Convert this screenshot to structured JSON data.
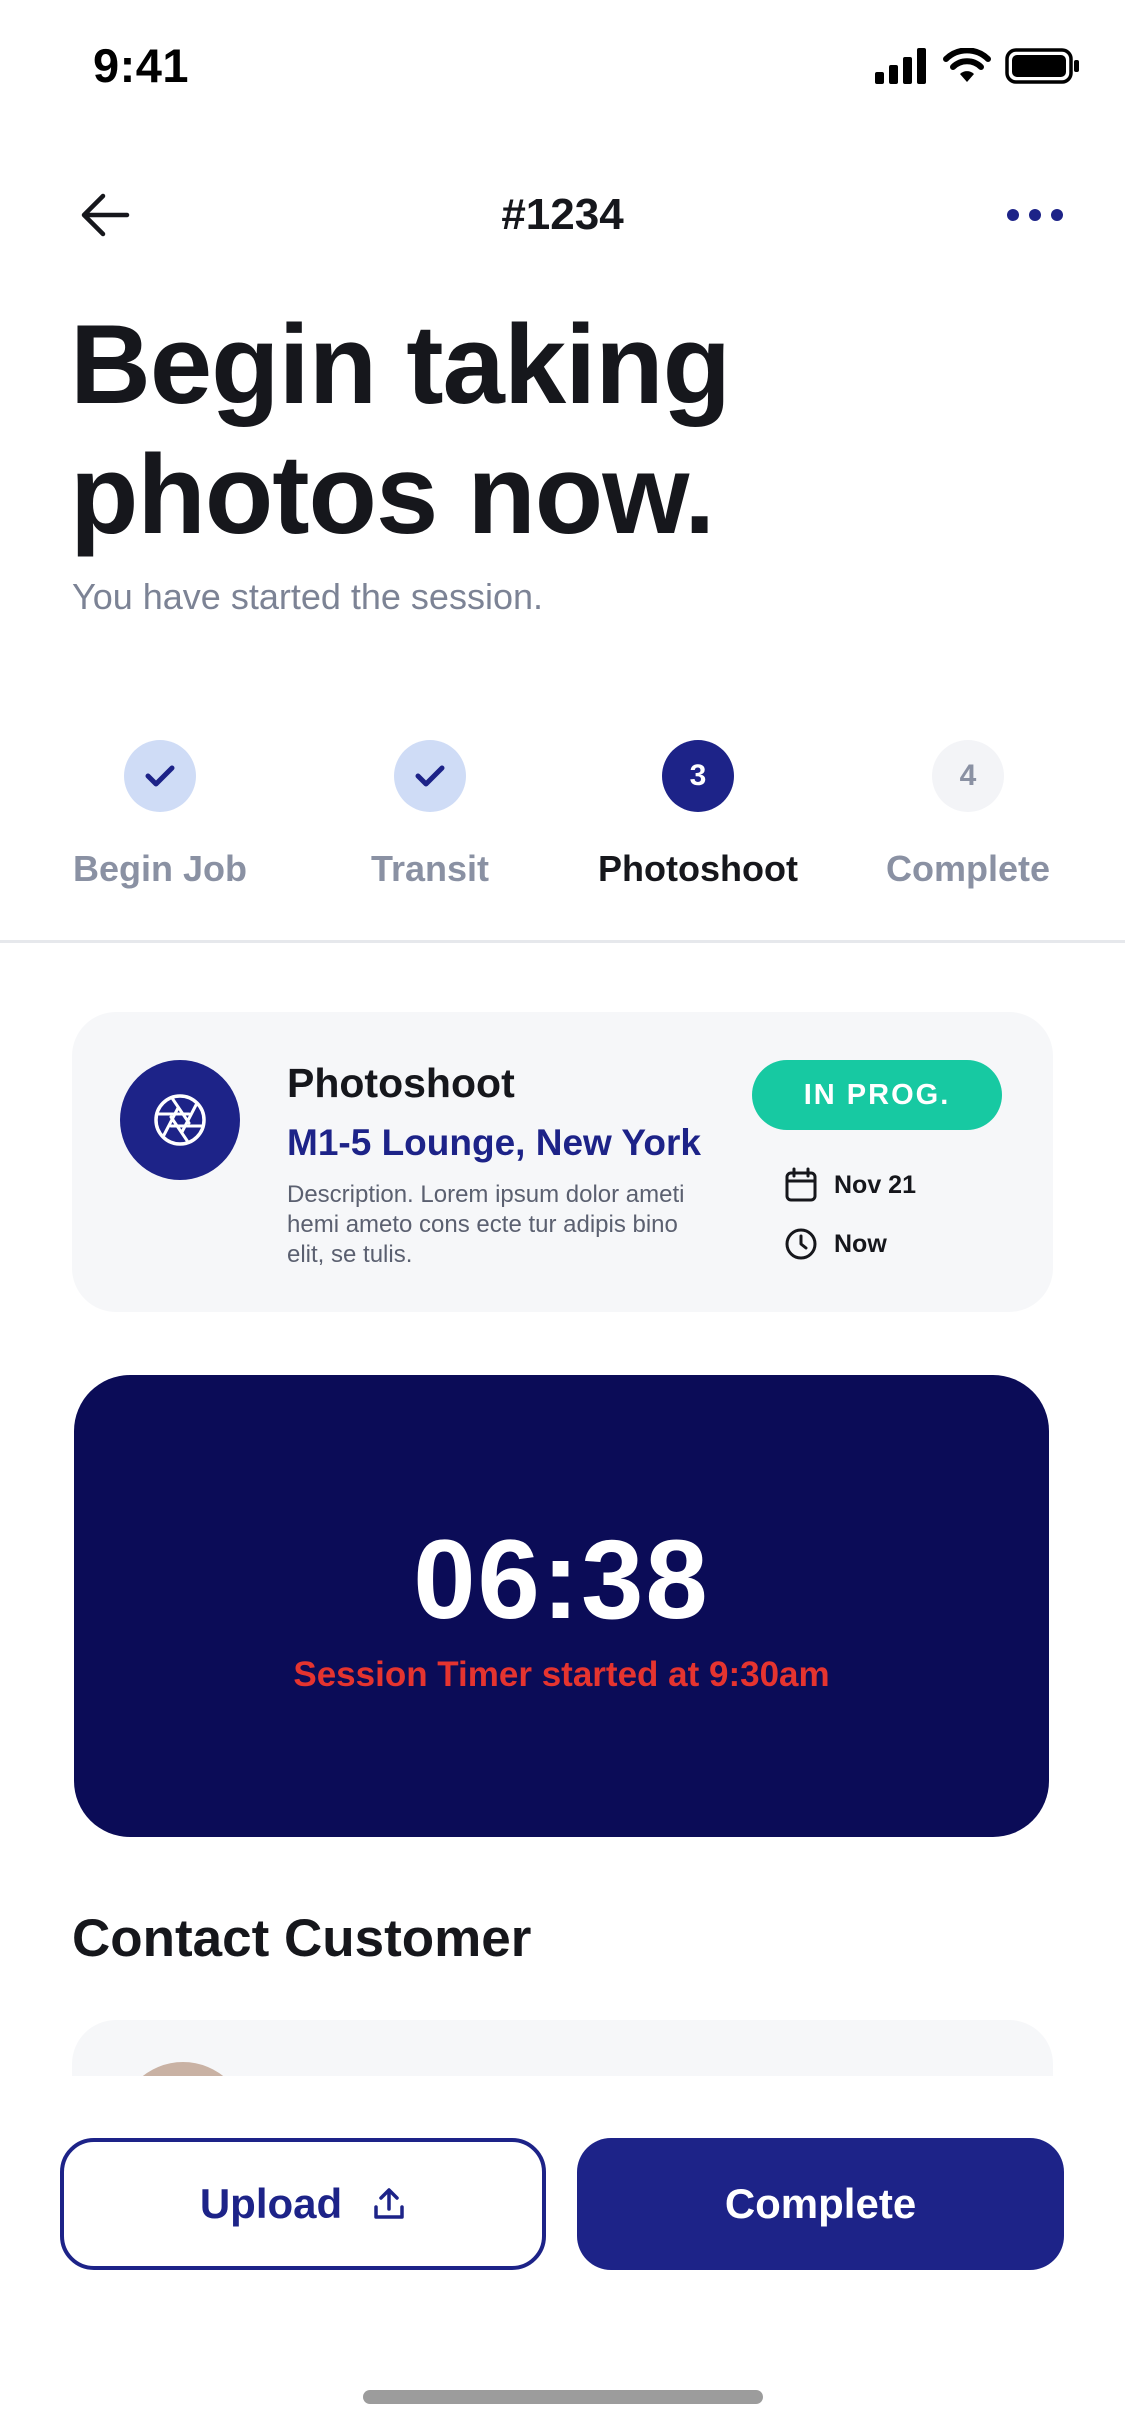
{
  "status_bar": {
    "time": "9:41"
  },
  "nav": {
    "title": "#1234"
  },
  "header": {
    "title": "Begin taking photos now.",
    "subtitle": "You have started the session."
  },
  "stepper": {
    "steps": [
      {
        "label": "Begin Job",
        "state": "done",
        "number": ""
      },
      {
        "label": "Transit",
        "state": "done",
        "number": ""
      },
      {
        "label": "Photoshoot",
        "state": "active",
        "number": "3"
      },
      {
        "label": "Complete",
        "state": "todo",
        "number": "4"
      }
    ]
  },
  "job": {
    "title": "Photoshoot",
    "location": "M1-5 Lounge, New York",
    "description": "Description. Lorem ipsum dolor ameti hemi ameto cons ecte tur adipis bino elit, se tulis.",
    "status": "IN PROG.",
    "date": "Nov 21",
    "time": "Now",
    "icon": "camera-aperture-icon"
  },
  "timer": {
    "value": "06:38",
    "note": "Session Timer started at 9:30am"
  },
  "contact": {
    "title": "Contact Customer"
  },
  "actions": {
    "upload_label": "Upload",
    "complete_label": "Complete"
  },
  "colors": {
    "primary": "#1d2388",
    "timer_bg": "#0b0c57",
    "status_green": "#17c9a2",
    "alert_red": "#e5342f"
  }
}
